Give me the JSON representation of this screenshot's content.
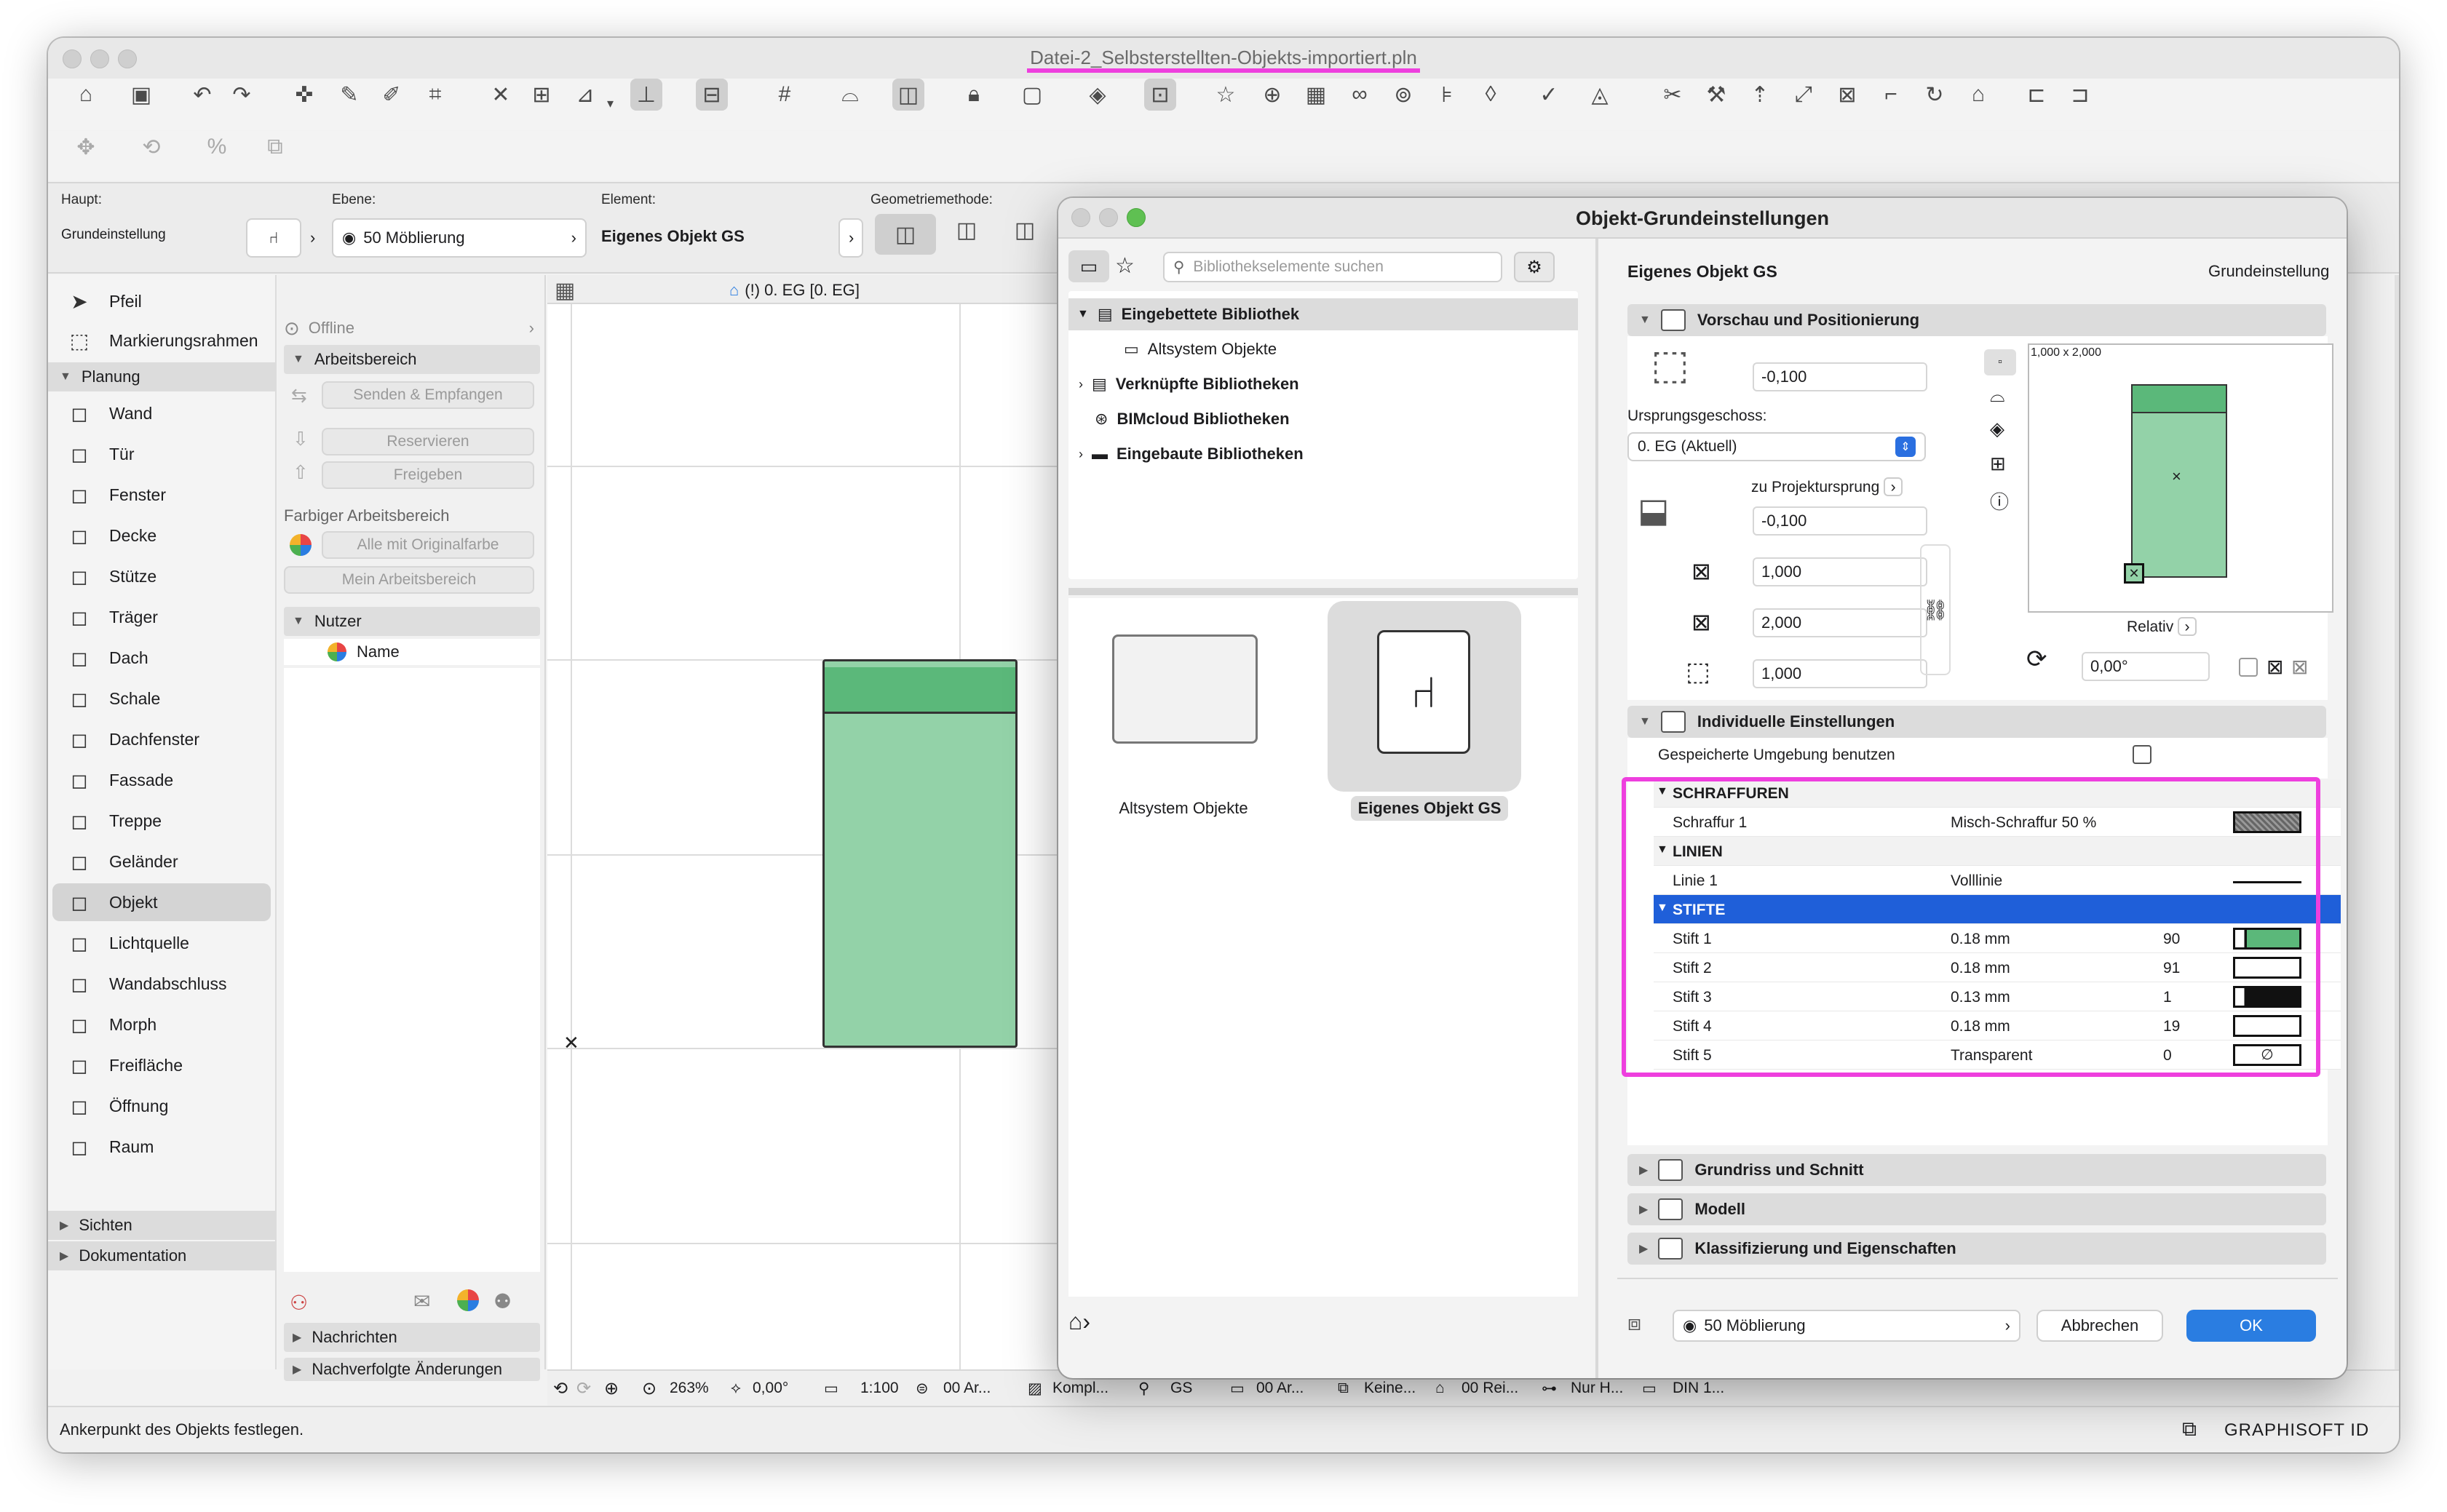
{
  "window": {
    "title": "Datei-2_Selbsterstellten-Objekts-importiert.pln"
  },
  "infobox": {
    "haupt_label": "Haupt:",
    "grundeinstellung": "Grundeinstellung",
    "ebene_label": "Ebene:",
    "ebene_value": "50 Möblierung",
    "element_label": "Element:",
    "element_value": "Eigenes Objekt GS",
    "geometrie_label": "Geometriemethode:"
  },
  "toolbox": {
    "top": [
      {
        "name": "pfeil",
        "label": "Pfeil",
        "icon": "arrow-icon"
      },
      {
        "name": "markierungsrahmen",
        "label": "Markierungsrahmen",
        "icon": "marquee-icon"
      }
    ],
    "groups": {
      "planung": "Planung",
      "sichten": "Sichten",
      "dokumentation": "Dokumentation"
    },
    "planung_items": [
      {
        "name": "wand",
        "label": "Wand",
        "icon": "wall-icon"
      },
      {
        "name": "tuer",
        "label": "Tür",
        "icon": "door-icon"
      },
      {
        "name": "fenster",
        "label": "Fenster",
        "icon": "window-icon"
      },
      {
        "name": "decke",
        "label": "Decke",
        "icon": "slab-icon"
      },
      {
        "name": "stuetze",
        "label": "Stütze",
        "icon": "column-icon"
      },
      {
        "name": "traeger",
        "label": "Träger",
        "icon": "beam-icon"
      },
      {
        "name": "dach",
        "label": "Dach",
        "icon": "roof-icon"
      },
      {
        "name": "schale",
        "label": "Schale",
        "icon": "shell-icon"
      },
      {
        "name": "dachfenster",
        "label": "Dachfenster",
        "icon": "skylight-icon"
      },
      {
        "name": "fassade",
        "label": "Fassade",
        "icon": "curtain-wall-icon"
      },
      {
        "name": "treppe",
        "label": "Treppe",
        "icon": "stair-icon"
      },
      {
        "name": "gelaender",
        "label": "Geländer",
        "icon": "railing-icon"
      },
      {
        "name": "objekt",
        "label": "Objekt",
        "icon": "object-chair-icon",
        "selected": true
      },
      {
        "name": "lichtquelle",
        "label": "Lichtquelle",
        "icon": "lamp-icon"
      },
      {
        "name": "wandabschluss",
        "label": "Wandabschluss",
        "icon": "wall-end-icon"
      },
      {
        "name": "morph",
        "label": "Morph",
        "icon": "morph-icon"
      },
      {
        "name": "freiflaeche",
        "label": "Freifläche",
        "icon": "mesh-icon"
      },
      {
        "name": "oeffnung",
        "label": "Öffnung",
        "icon": "opening-icon"
      },
      {
        "name": "raum",
        "label": "Raum",
        "icon": "zone-icon"
      }
    ]
  },
  "teamwork": {
    "offline": "Offline",
    "arbeitsbereich": "Arbeitsbereich",
    "senden": "Senden & Empfangen",
    "reservieren": "Reservieren",
    "freigeben": "Freigeben",
    "farbiger": "Farbiger Arbeitsbereich",
    "alle_original": "Alle mit Originalfarbe",
    "mein_arbeitsbereich": "Mein Arbeitsbereich",
    "nutzer": "Nutzer",
    "name_col": "Name",
    "nachrichten": "Nachrichten",
    "nachverfolgte": "Nachverfolgte Änderungen"
  },
  "canvas": {
    "tab_label": "(!) 0. EG [0. EG]"
  },
  "statusbar": {
    "zoom": "263%",
    "angle": "0,00°",
    "scale": "1:100",
    "layers": "00 Ar...",
    "komplex": "Kompl...",
    "gs": "GS",
    "ar2": "00 Ar...",
    "keine": "Keine...",
    "rei": "00 Rei...",
    "nur_h": "Nur H...",
    "din": "DIN 1..."
  },
  "footer": {
    "hint": "Ankerpunkt des Objekts festlegen.",
    "brand": "GRAPHISOFT ID"
  },
  "dialog": {
    "title": "Objekt-Grundeinstellungen",
    "search_placeholder": "Bibliothekselemente suchen",
    "tree": [
      {
        "label": "Eingebettete Bibliothek",
        "bold": true
      },
      {
        "label": "Altsystem Objekte",
        "bold": false
      },
      {
        "label": "Verknüpfte Bibliotheken",
        "bold": true
      },
      {
        "label": "BIMcloud Bibliotheken",
        "bold": true
      },
      {
        "label": "Eingebaute Bibliotheken",
        "bold": true
      }
    ],
    "tiles": [
      {
        "label": "Altsystem Objekte"
      },
      {
        "label": "Eigenes Objekt GS"
      }
    ],
    "header_name": "Eigenes Objekt GS",
    "header_right": "Grundeinstellung",
    "sections": {
      "vorschau": "Vorschau und Positionierung",
      "individuelle": "Individuelle Einstellungen",
      "grundriss": "Grundriss und Schnitt",
      "modell": "Modell",
      "klassifizierung": "Klassifizierung und Eigenschaften"
    },
    "pos": {
      "offset_top": "-0,100",
      "ursprung_label": "Ursprungsgeschoss:",
      "ursprung_value": "0. EG (Aktuell)",
      "projekt_label": "zu Projektursprung",
      "offset_bottom": "-0,100",
      "x": "1,000",
      "y": "2,000",
      "z": "1,000",
      "preview_size": "1,000 x 2,000",
      "relativ": "Relativ",
      "angle": "0,00°"
    },
    "gespeicherte": "Gespeicherte Umgebung benutzen",
    "params": [
      {
        "type": "header",
        "name": "SCHRAFFUREN"
      },
      {
        "type": "row",
        "name": "Schraffur 1",
        "value": "Misch-Schraffur 50 %",
        "num": "",
        "swatch": "hatch"
      },
      {
        "type": "header",
        "name": "LINIEN"
      },
      {
        "type": "row",
        "name": "Linie 1",
        "value": "Volllinie",
        "num": "",
        "swatch": "line"
      },
      {
        "type": "header",
        "name": "STIFTE",
        "selected": true
      },
      {
        "type": "row",
        "name": "Stift 1",
        "value": "0.18 mm",
        "num": "90",
        "swatch": "green"
      },
      {
        "type": "row",
        "name": "Stift 2",
        "value": "0.18 mm",
        "num": "91",
        "swatch": "white"
      },
      {
        "type": "row",
        "name": "Stift 3",
        "value": "0.13 mm",
        "num": "1",
        "swatch": "black"
      },
      {
        "type": "row",
        "name": "Stift 4",
        "value": "0.18 mm",
        "num": "19",
        "swatch": "white2"
      },
      {
        "type": "row",
        "name": "Stift 5",
        "value": "Transparent",
        "num": "0",
        "swatch": "transparent"
      }
    ],
    "layer": "50 Möblierung",
    "cancel": "Abbrechen",
    "ok": "OK"
  },
  "colors": {
    "accent": "#1f5fd9",
    "highlight": "#ee3fde",
    "object_fill": "#93d2a8",
    "object_top": "#5bb87a"
  }
}
